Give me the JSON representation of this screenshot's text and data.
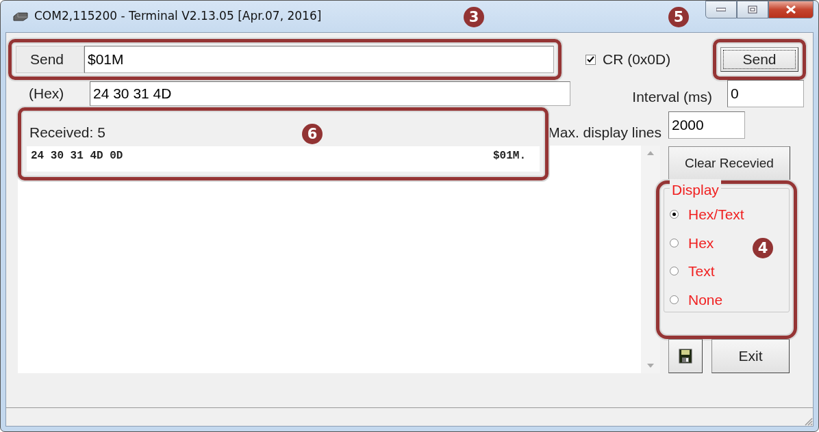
{
  "window": {
    "title": "COM2,115200 - Terminal V2.13.05 [Apr.07, 2016]"
  },
  "send": {
    "label": "Send",
    "value": "$01M",
    "callout": "3"
  },
  "hex": {
    "label": "(Hex)",
    "value": "24 30 31 4D"
  },
  "cr_option": {
    "label": "CR (0x0D)",
    "checked": true
  },
  "send_button": {
    "label": "Send",
    "callout": "5"
  },
  "interval": {
    "label": "Interval (ms)",
    "value": "0"
  },
  "max_lines": {
    "label": "Max. display lines",
    "value": "2000"
  },
  "received": {
    "label": "Received: 5",
    "callout": "6",
    "lines": [
      {
        "hex": "24 30 31 4D 0D",
        "text": "$01M."
      }
    ]
  },
  "clear_button": "Clear Recevied",
  "display": {
    "title": "Display",
    "callout": "4",
    "options": [
      {
        "label": "Hex/Text",
        "selected": true
      },
      {
        "label": "Hex",
        "selected": false
      },
      {
        "label": "Text",
        "selected": false
      },
      {
        "label": "None",
        "selected": false
      }
    ]
  },
  "exit_button": "Exit"
}
